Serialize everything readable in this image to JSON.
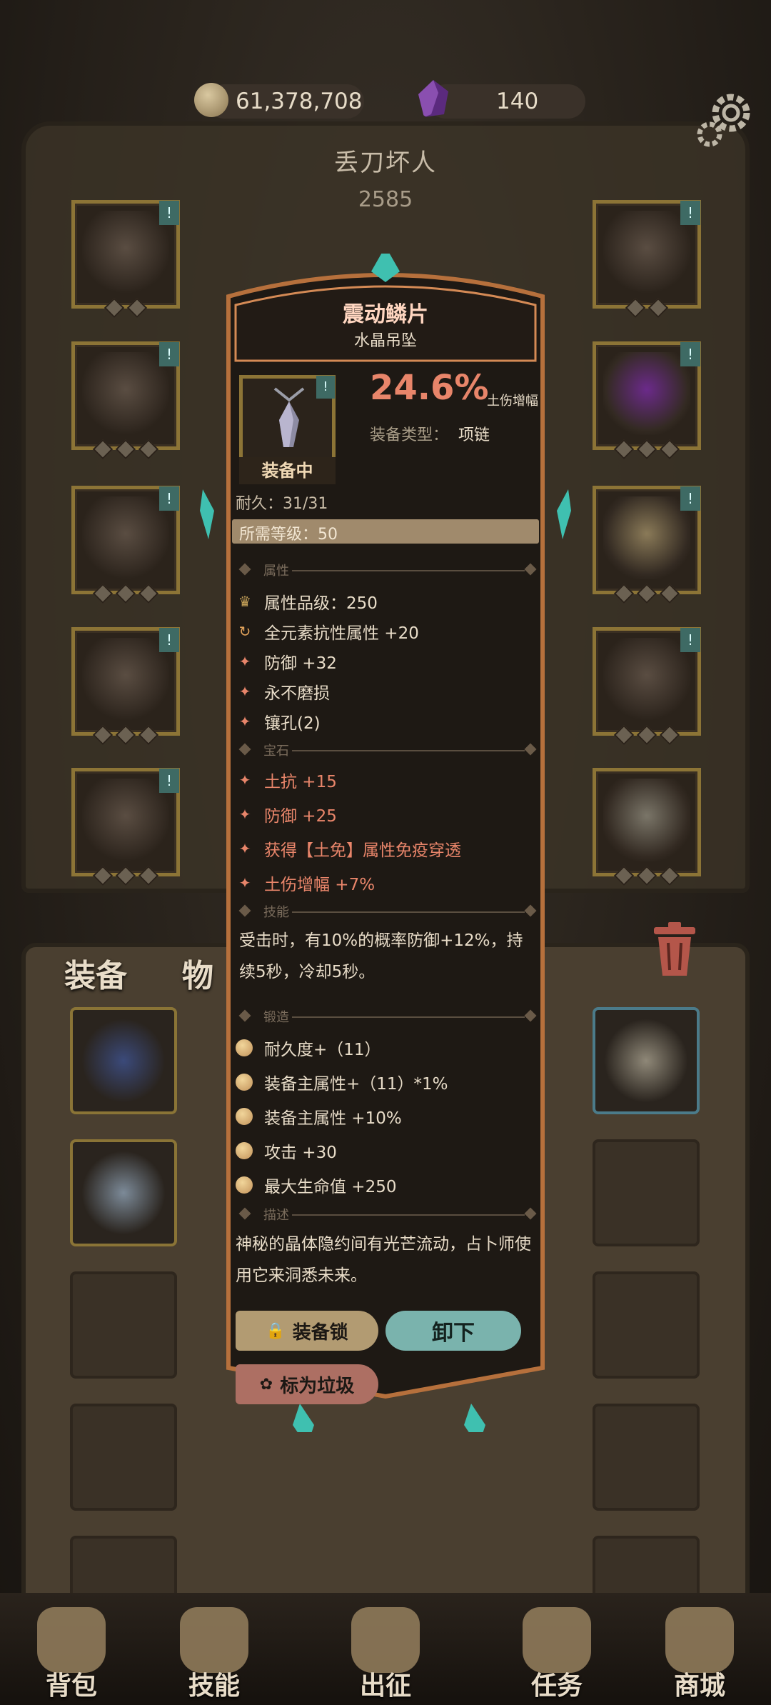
{
  "resources": {
    "gold": "61,378,708",
    "crystals": "140"
  },
  "player": {
    "name": "丢刀坏人",
    "level": "2585"
  },
  "left_tabs": {
    "equip": "装备",
    "items": "物"
  },
  "nav": [
    {
      "label": "背包",
      "icon": "backpack-icon"
    },
    {
      "label": "技能",
      "icon": "skill-book-icon"
    },
    {
      "label": "出征",
      "icon": "sword-map-icon"
    },
    {
      "label": "任务",
      "icon": "scroll-icon"
    },
    {
      "label": "商城",
      "icon": "shop-crown-icon"
    }
  ],
  "tooltip": {
    "title": "震动鳞片",
    "subtitle": "水晶吊坠",
    "flag": "!",
    "equipped_label": "装备中",
    "main_percent": "24.6%",
    "main_percent_label": "土伤增幅",
    "equip_type_label": "装备类型：",
    "equip_type_value": "项链",
    "durability": "耐久：31/31",
    "required_level": "所需等级：50",
    "sections": {
      "attributes": "属性",
      "gems": "宝石",
      "skills": "技能",
      "forging": "锻造",
      "description": "描述"
    },
    "attributes": [
      "属性品级：250",
      "全元素抗性属性 +20",
      "防御 +32",
      "永不磨损",
      "镶孔(2)"
    ],
    "gems": [
      "土抗 +15",
      "防御 +25",
      "获得【土免】属性免疫穿透",
      "土伤增幅 +7%"
    ],
    "skill_text": "受击时，有10%的概率防御+12%，持续5秒，冷却5秒。",
    "forging": [
      "耐久度+（11）",
      "装备主属性+（11）*1%",
      "装备主属性 +10%",
      "攻击 +30",
      "最大生命值 +250"
    ],
    "description_text": "神秘的晶体隐约间有光芒流动，占卜师使用它来洞悉未来。",
    "buttons": {
      "lock": "装备锁",
      "unequip": "卸下",
      "junk": "标为垃圾"
    }
  },
  "colors": {
    "accent_orange": "#e8856a",
    "frame_gold": "#8c7436",
    "teal": "#7ab3ad"
  }
}
